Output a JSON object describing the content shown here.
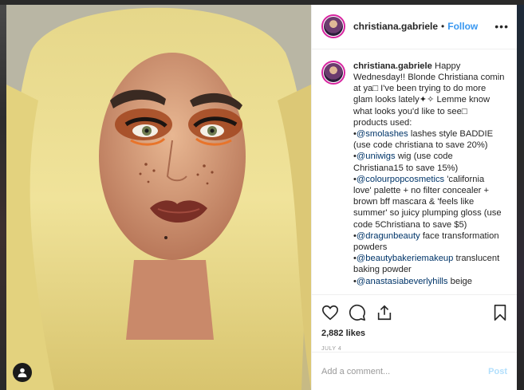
{
  "post": {
    "username": "christiana.gabriele",
    "separator": "•",
    "follow_label": "Follow",
    "more_icon": "more-options-icon",
    "more_glyph": "•••"
  },
  "caption": {
    "username": "christiana.gabriele",
    "lines": [
      " Happy",
      "Wednesday!! Blonde Christiana comin",
      "at ya□ I've been trying to do more",
      "glam looks lately✦✧ Lemme know",
      "what looks you'd like to see□",
      "products used:"
    ],
    "items": [
      {
        "bullet": "•",
        "mention": "@smolashes",
        "text": " lashes style BADDIE"
      },
      {
        "bullet": "",
        "mention": "",
        "text": "(use code christiana to save 20%)"
      },
      {
        "bullet": "•",
        "mention": "@uniwigs",
        "text": " wig (use code"
      },
      {
        "bullet": "",
        "mention": "",
        "text": "Christiana15 to save 15%)"
      },
      {
        "bullet": "•",
        "mention": "@colourpopcosmetics",
        "text": " 'california"
      },
      {
        "bullet": "",
        "mention": "",
        "text": "love' palette + no filter concealer +"
      },
      {
        "bullet": "",
        "mention": "",
        "text": "brown bff mascara & 'feels like"
      },
      {
        "bullet": "",
        "mention": "",
        "text": "summer' so juicy plumping gloss (use"
      },
      {
        "bullet": "",
        "mention": "",
        "text": "code 5Christiana to save $5)"
      },
      {
        "bullet": "•",
        "mention": "@dragunbeauty",
        "text": " face transformation"
      },
      {
        "bullet": "",
        "mention": "",
        "text": "powders"
      },
      {
        "bullet": "•",
        "mention": "@beautybakeriemakeup",
        "text": " translucent"
      },
      {
        "bullet": "",
        "mention": "",
        "text": "baking powder"
      },
      {
        "bullet": "•",
        "mention": "@anastasiabeverlyhills",
        "text": " beige"
      }
    ]
  },
  "stats": {
    "likes": "2,882 likes",
    "date": "JULY 4"
  },
  "comment_box": {
    "placeholder": "Add a comment...",
    "post_label": "Post"
  },
  "icons": {
    "like": "heart-icon",
    "comment": "comment-icon",
    "share": "share-icon",
    "save": "bookmark-icon",
    "tag": "user-tag-icon"
  },
  "colors": {
    "link": "#3897f0",
    "mention": "#003569",
    "post_disabled": "#b2dffc",
    "muted": "#999999",
    "text": "#262626"
  }
}
